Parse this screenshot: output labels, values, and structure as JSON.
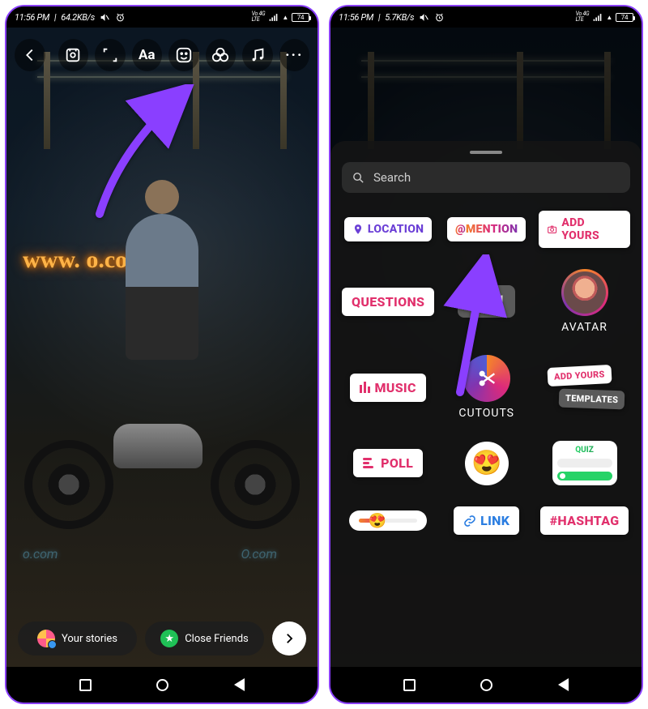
{
  "status": {
    "time": "11:56 PM",
    "net_left": "64.2KB/s",
    "net_right": "5.7KB/s",
    "battery": "74"
  },
  "editor": {
    "neon_text": "www.        o.com",
    "reflection1": "o.com",
    "reflection2": "O.com",
    "text_tool": "Aa",
    "more": "···",
    "your_stories": "Your stories",
    "close_friends": "Close Friends",
    "cf_star": "★"
  },
  "tray": {
    "search_placeholder": "Search",
    "location": "LOCATION",
    "mention_at": "@",
    "mention": "MENTION",
    "add_yours": "ADD YOURS",
    "questions": "QUESTIONS",
    "gif": "GI",
    "avatar": "AVATAR",
    "music": "MUSIC",
    "cutouts": "CUTOUTS",
    "templates_top": "ADD YOURS",
    "templates_bottom": "TEMPLATES",
    "poll": "POLL",
    "emoji": "😍",
    "quiz": "QUIZ",
    "link": "LINK",
    "hashtag": "#HASHTAG"
  }
}
